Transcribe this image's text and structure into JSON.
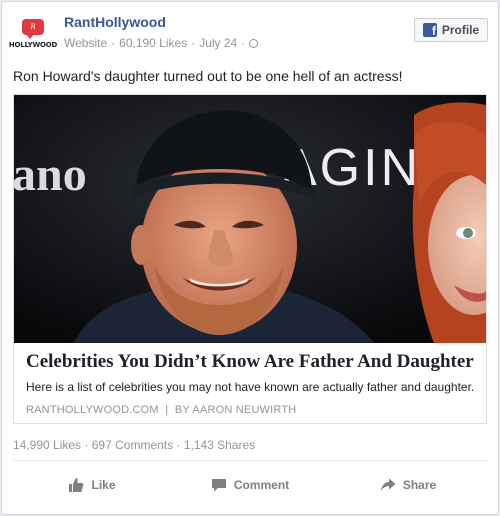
{
  "post": {
    "page_name": "RantHollywood",
    "avatar_logo_text": "HOLLYWOOD",
    "meta_type": "Website",
    "meta_likes": "60,190 Likes",
    "meta_date": "July 24",
    "profile_button": "Profile",
    "message": "Ron Howard's daughter turned out to be one hell of an actress!"
  },
  "link": {
    "title": "Celebrities You Didn’t Know Are Father And Daughter",
    "description": "Here is a list of celebrities you may not have known are actually father and daughter.",
    "source": "RANTHOLLYWOOD.COM",
    "author": "BY AARON NEUWIRTH",
    "photo_text_left": "ano",
    "photo_text_right": "AGIN"
  },
  "stats": {
    "likes": "14,990 Likes",
    "comments": "697 Comments",
    "shares": "1,143 Shares"
  },
  "actions": {
    "like": "Like",
    "comment": "Comment",
    "share": "Share"
  },
  "icons": {
    "facebook": "facebook-icon",
    "globe": "globe-icon",
    "like": "thumbs-up-icon",
    "comment": "speech-bubble-icon",
    "share": "share-arrow-icon"
  },
  "colors": {
    "link_blue": "#365899",
    "text": "#1d2129",
    "muted": "#90949c",
    "brand_red": "#e0393e",
    "facebook_blue": "#3b5998"
  }
}
